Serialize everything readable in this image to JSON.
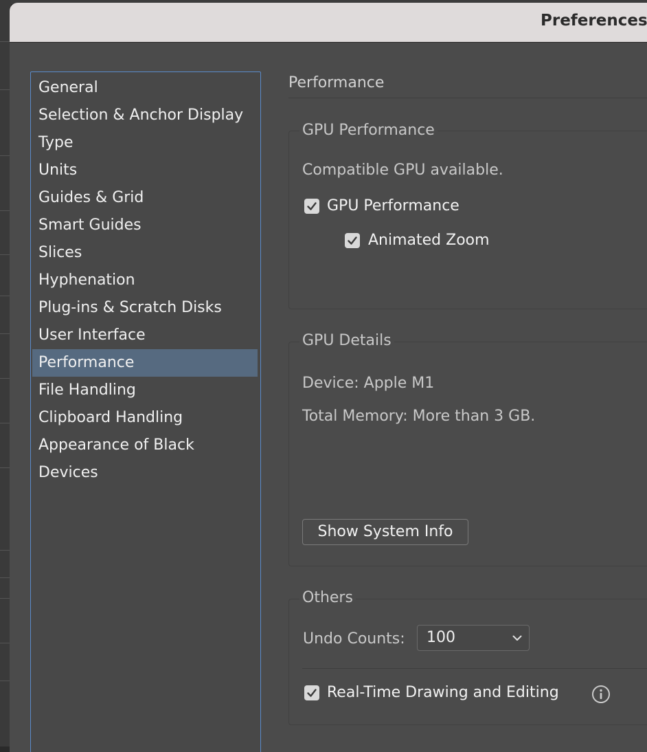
{
  "window": {
    "title": "Preferences"
  },
  "sidebar": {
    "items": [
      {
        "label": "General"
      },
      {
        "label": "Selection & Anchor Display"
      },
      {
        "label": "Type"
      },
      {
        "label": "Units"
      },
      {
        "label": "Guides & Grid"
      },
      {
        "label": "Smart Guides"
      },
      {
        "label": "Slices"
      },
      {
        "label": "Hyphenation"
      },
      {
        "label": "Plug-ins & Scratch Disks"
      },
      {
        "label": "User Interface"
      },
      {
        "label": "Performance"
      },
      {
        "label": "File Handling"
      },
      {
        "label": "Clipboard Handling"
      },
      {
        "label": "Appearance of Black"
      },
      {
        "label": "Devices"
      }
    ],
    "selected": "Performance"
  },
  "main": {
    "section_title": "Performance",
    "gpu_performance": {
      "label": "GPU Performance",
      "status": "Compatible GPU available.",
      "gpu_checkbox_label": "GPU Performance",
      "gpu_checked": true,
      "animated_zoom_label": "Animated Zoom",
      "animated_zoom_checked": true
    },
    "gpu_details": {
      "label": "GPU Details",
      "device": "Device: Apple M1",
      "memory": "Total Memory:  More than 3 GB.",
      "button_label": "Show System Info"
    },
    "others": {
      "label": "Others",
      "undo_label": "Undo Counts:",
      "undo_value": "100",
      "realtime_label": "Real-Time Drawing and Editing",
      "realtime_checked": true
    }
  },
  "icons": {
    "checkmark": "checkmark-icon",
    "dropdown": "chevron-down-icon",
    "info": "info-icon"
  }
}
